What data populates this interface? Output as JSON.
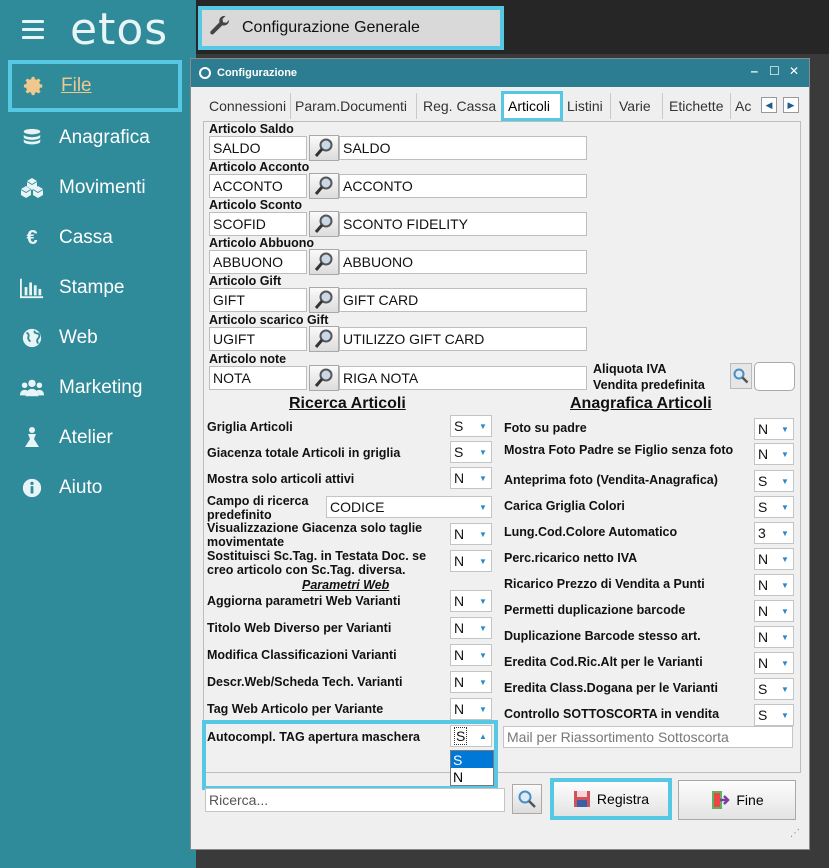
{
  "sidebar": {
    "logo": "etos",
    "items": [
      {
        "label": "File",
        "icon": "gear-icon"
      },
      {
        "label": "Anagrafica",
        "icon": "database-icon"
      },
      {
        "label": "Movimenti",
        "icon": "boxes-icon"
      },
      {
        "label": "Cassa",
        "icon": "euro-icon"
      },
      {
        "label": "Stampe",
        "icon": "bar-chart-icon"
      },
      {
        "label": "Web",
        "icon": "globe-icon"
      },
      {
        "label": "Marketing",
        "icon": "users-icon"
      },
      {
        "label": "Atelier",
        "icon": "dress-icon"
      },
      {
        "label": "Aiuto",
        "icon": "info-icon"
      }
    ]
  },
  "header": {
    "tab_label": "Configurazione Generale"
  },
  "window": {
    "title": "Configurazione",
    "tabs": [
      "Connessioni",
      "Param.Documenti",
      "Reg. Cassa",
      "Articoli",
      "Listini",
      "Varie",
      "Etichette",
      "Ac"
    ],
    "active_tab": "Articoli",
    "articoli": [
      {
        "label": "Articolo Saldo",
        "code": "SALDO",
        "desc": "SALDO"
      },
      {
        "label": "Articolo Acconto",
        "code": "ACCONTO",
        "desc": "ACCONTO"
      },
      {
        "label": "Articolo Sconto",
        "code": "SCOFID",
        "desc": "SCONTO FIDELITY"
      },
      {
        "label": "Articolo Abbuono",
        "code": "ABBUONO",
        "desc": "ABBUONO"
      },
      {
        "label": "Articolo Gift",
        "code": "GIFT",
        "desc": "GIFT CARD"
      },
      {
        "label": "Articolo scarico Gift",
        "code": "UGIFT",
        "desc": "UTILIZZO GIFT CARD"
      },
      {
        "label": "Articolo note",
        "code": "NOTA",
        "desc": "RIGA NOTA"
      }
    ],
    "aliquota_label_1": "Aliquota IVA",
    "aliquota_label_2": "Vendita predefinita",
    "ricerca_title": "Ricerca Articoli",
    "anagrafica_title": "Anagrafica Articoli",
    "left_options": [
      {
        "label": "Griglia Articoli",
        "value": "S"
      },
      {
        "label": "Giacenza totale Articoli in griglia",
        "value": "S"
      },
      {
        "label": "Mostra solo articoli attivi",
        "value": "N"
      }
    ],
    "campo_ricerca_label_1": "Campo di ricerca",
    "campo_ricerca_label_2": "predefinito",
    "campo_ricerca_value": "CODICE",
    "vis_giacenza_label_1": "Visualizzazione Giacenza solo taglie",
    "vis_giacenza_label_2": "movimentate",
    "vis_giacenza_value": "N",
    "sostituisci_label_1": "Sostituisci Sc.Tag. in Testata Doc. se",
    "sostituisci_label_2": "creo articolo con Sc.Tag. diversa.",
    "sostituisci_value": "N",
    "parametri_web_title": "Parametri Web",
    "web_options": [
      {
        "label": "Aggiorna parametri Web Varianti",
        "value": "N"
      },
      {
        "label": "Titolo Web Diverso per Varianti",
        "value": "N"
      },
      {
        "label": "Modifica Classificazioni Varianti",
        "value": "N"
      },
      {
        "label": "Descr.Web/Scheda Tech. Varianti",
        "value": "N"
      },
      {
        "label": "Tag Web Articolo per Variante",
        "value": "N"
      }
    ],
    "autocompl_label": "Autocompl. TAG apertura maschera",
    "autocompl_value": "S",
    "autocompl_options": [
      "S",
      "N"
    ],
    "right_options": [
      {
        "label": "Foto su padre",
        "value": "N"
      },
      {
        "label": "Mostra Foto Padre se Figlio senza foto",
        "value": "N"
      },
      {
        "label": "Anteprima foto (Vendita-Anagrafica)",
        "value": "S"
      },
      {
        "label": "Carica Griglia Colori",
        "value": "S"
      },
      {
        "label": "Lung.Cod.Colore Automatico",
        "value": "3"
      },
      {
        "label": "Perc.ricarico netto IVA",
        "value": "N"
      },
      {
        "label": "Ricarico Prezzo di Vendita a Punti",
        "value": "N"
      },
      {
        "label": "Permetti duplicazione barcode",
        "value": "N"
      },
      {
        "label": "Duplicazione Barcode stesso art.",
        "value": "N"
      },
      {
        "label": "Eredita Cod.Ric.Alt per le Varianti",
        "value": "N"
      },
      {
        "label": "Eredita Class.Dogana per le Varianti",
        "value": "S"
      },
      {
        "label": "Controllo SOTTOSCORTA in vendita",
        "value": "S"
      }
    ],
    "mail_placeholder": "Mail per Riassortimento Sottoscorta",
    "search_placeholder": "Ricerca...",
    "registra_label": "Registra",
    "fine_label": "Fine"
  }
}
